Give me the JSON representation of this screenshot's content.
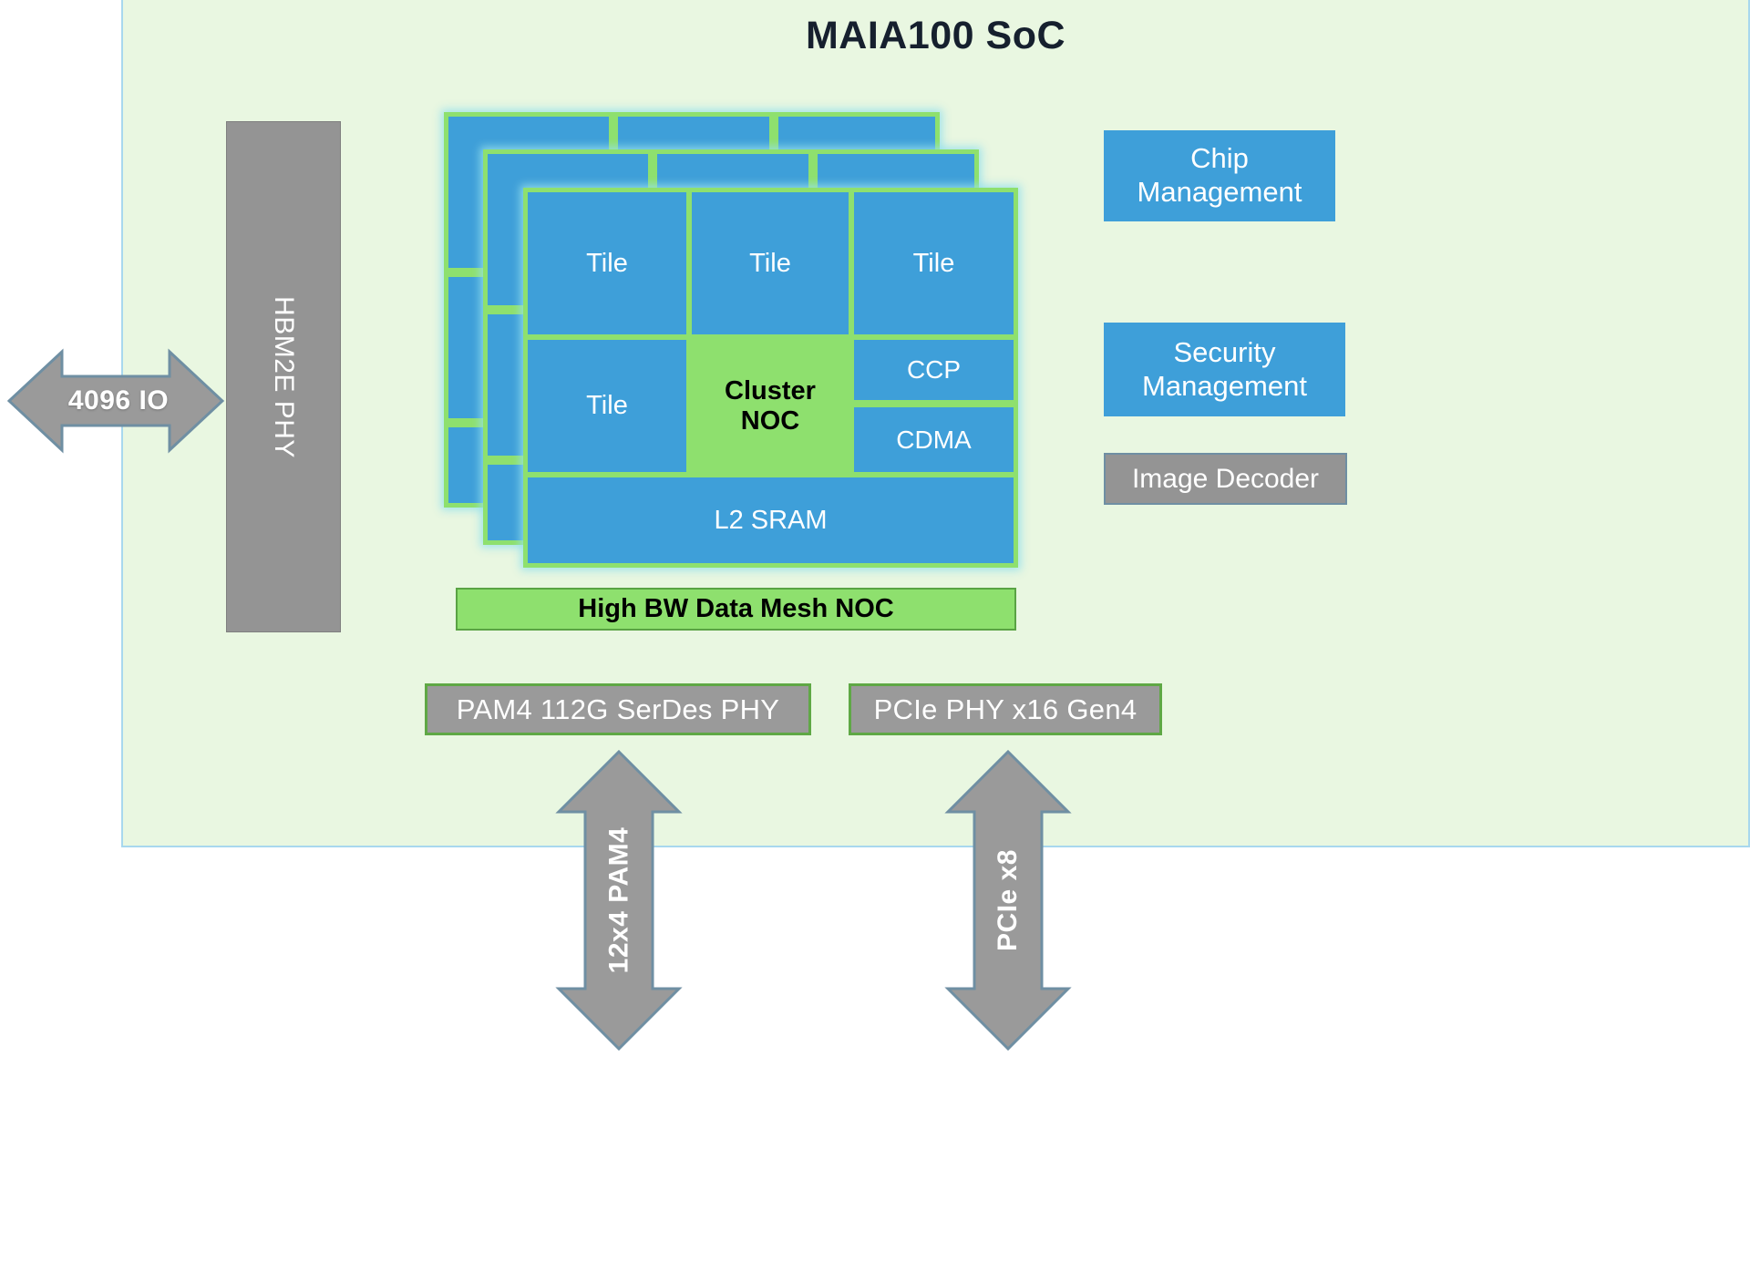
{
  "diagram": {
    "title": "MAIA100 SoC",
    "accent_green": "#8ee06e",
    "accent_blue": "#3e9fd9",
    "accent_gray": "#949494",
    "container_bg": "#e9f7e1",
    "container_border": "#a8d8ee",
    "title_color": "#16202e"
  },
  "memory": {
    "phy_label": "HBM2E PHY",
    "io_arrow_label": "4096 IO"
  },
  "cluster": {
    "tiles": [
      "Tile",
      "Tile",
      "Tile",
      "Tile"
    ],
    "noc_label": "Cluster\nNOC",
    "noc_line1": "Cluster",
    "noc_line2": "NOC",
    "ccp_label": "CCP",
    "cdma_label": "CDMA",
    "l2_label": "L2 SRAM",
    "stack_count": 3
  },
  "mesh": {
    "label": "High BW Data Mesh NOC"
  },
  "right_column": {
    "chip_management_line1": "Chip",
    "chip_management_line2": "Management",
    "security_management_line1": "Security",
    "security_management_line2": "Management",
    "image_decoder": "Image Decoder"
  },
  "bottom_phys": [
    {
      "label": "PAM4 112G SerDes PHY",
      "arrow_label": "12x4 PAM4"
    },
    {
      "label": "PCIe PHY x16 Gen4",
      "arrow_label": "PCIe x8"
    }
  ]
}
